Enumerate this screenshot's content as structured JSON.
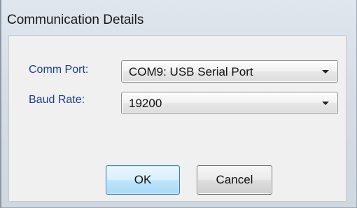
{
  "window": {
    "title": "Communication Details"
  },
  "form": {
    "comm_port_label": "Comm Port:",
    "comm_port_value": "COM9:  USB Serial Port",
    "baud_rate_label": "Baud Rate:",
    "baud_rate_value": "19200"
  },
  "buttons": {
    "ok_label": "OK",
    "cancel_label": "Cancel"
  },
  "icons": {
    "dropdown": "chevron-down-icon"
  }
}
